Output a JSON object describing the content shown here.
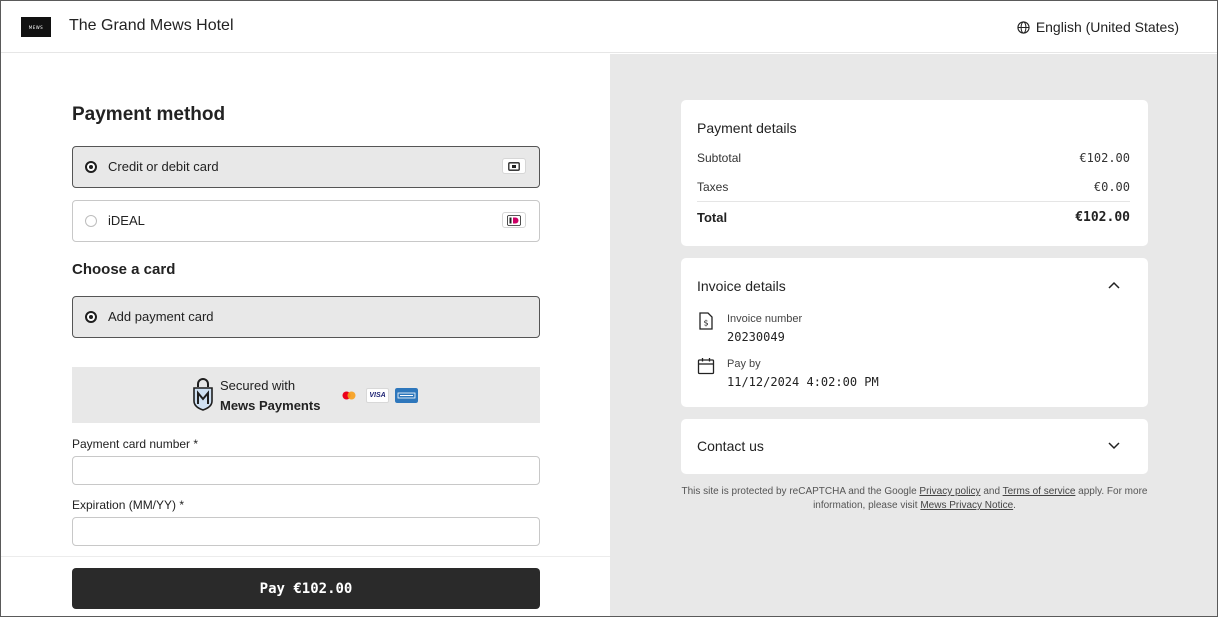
{
  "header": {
    "logo_text": "MEWS",
    "hotel_name": "The Grand Mews Hotel",
    "language": "English (United States)"
  },
  "payment": {
    "title": "Payment method",
    "options": [
      {
        "label": "Credit or debit card",
        "selected": true,
        "icon": "card-icon"
      },
      {
        "label": "iDEAL",
        "selected": false,
        "icon": "ideal-icon"
      }
    ],
    "choose_card_title": "Choose a card",
    "add_card_label": "Add payment card",
    "secured_line1": "Secured with",
    "secured_line2": "Mews Payments",
    "card_brands": [
      "mastercard-icon",
      "visa-icon",
      "amex-icon"
    ],
    "visa_text": "VISA",
    "card_number_label": "Payment card number *",
    "card_number_value": "",
    "expiration_label": "Expiration (MM/YY) *",
    "expiration_value": "",
    "pay_button": "Pay €102.00"
  },
  "summary": {
    "payment_details_title": "Payment details",
    "subtotal_label": "Subtotal",
    "subtotal_value": "€102.00",
    "taxes_label": "Taxes",
    "taxes_value": "€0.00",
    "total_label": "Total",
    "total_value": "€102.00",
    "invoice_title": "Invoice details",
    "invoice_number_label": "Invoice number",
    "invoice_number_value": "20230049",
    "pay_by_label": "Pay by",
    "pay_by_value": "11/12/2024 4:02:00 PM",
    "contact_title": "Contact us"
  },
  "footnote": {
    "part1": "This site is protected by reCAPTCHA and the Google ",
    "privacy_link": "Privacy policy",
    "part2": " and ",
    "terms_link": "Terms of service",
    "part3": " apply. For more information, please visit ",
    "mews_link": "Mews Privacy Notice",
    "part4": "."
  },
  "colors": {
    "accent_dark": "#2a2a2a",
    "panel_gray": "#e8e8e8",
    "mastercard_red": "#eb001b",
    "mastercard_orange": "#f79e1b",
    "visa_blue": "#1a1f71",
    "amex_blue": "#2e77bc",
    "ideal_pink": "#cc0066"
  }
}
